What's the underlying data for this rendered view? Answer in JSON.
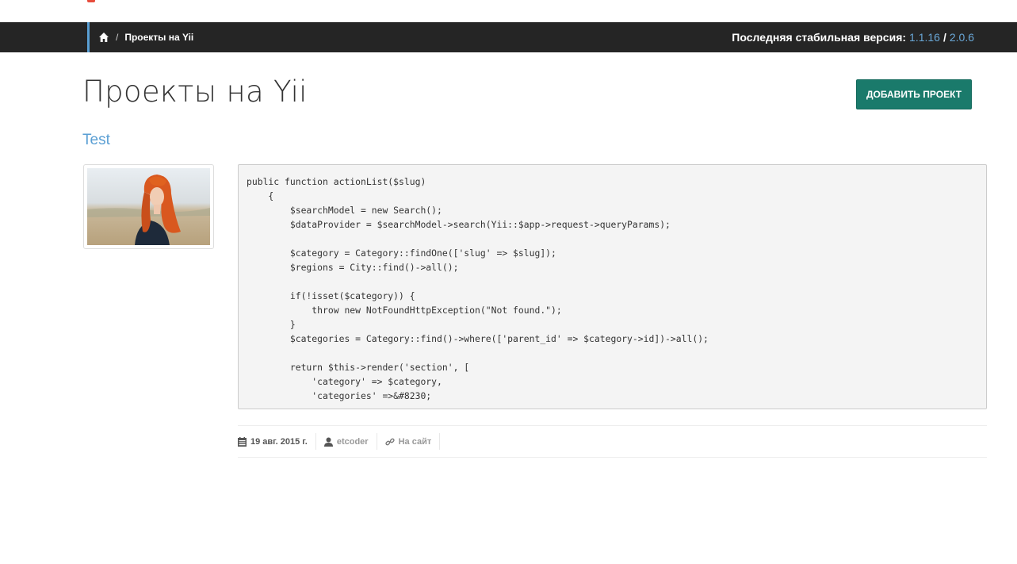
{
  "header": {
    "breadcrumb": {
      "separator": "/",
      "current": "Проекты на Yii"
    },
    "version": {
      "label": "Последняя стабильная версия:",
      "v1": "1.1.16",
      "sep": "/",
      "v2": "2.0.6"
    }
  },
  "page": {
    "title": "Проекты на Yii",
    "add_button": "ДОБАВИТЬ ПРОЕКТ"
  },
  "project": {
    "title": "Test",
    "code": "public function actionList($slug)\n    {\n        $searchModel = new Search();\n        $dataProvider = $searchModel->search(Yii::$app->request->queryParams);\n\n        $category = Category::findOne(['slug' => $slug]);\n        $regions = City::find()->all();\n\n        if(!isset($category)) {\n            throw new NotFoundHttpException(\"Not found.\");\n        }\n        $categories = Category::find()->where(['parent_id' => $category->id])->all();\n\n        return $this->render('section', [\n            'category' => $category,\n            'categories' =>&#8230;",
    "meta": {
      "date": "19 авг. 2015 г.",
      "author": "etcoder",
      "site": "На сайт"
    }
  },
  "icons": [
    "home-icon",
    "calendar-icon",
    "user-icon",
    "link-icon"
  ],
  "colors": {
    "topbar": "#252525",
    "accent": "#5a9fd4",
    "button": "#1a7a6b",
    "link": "#6aa8d8"
  }
}
